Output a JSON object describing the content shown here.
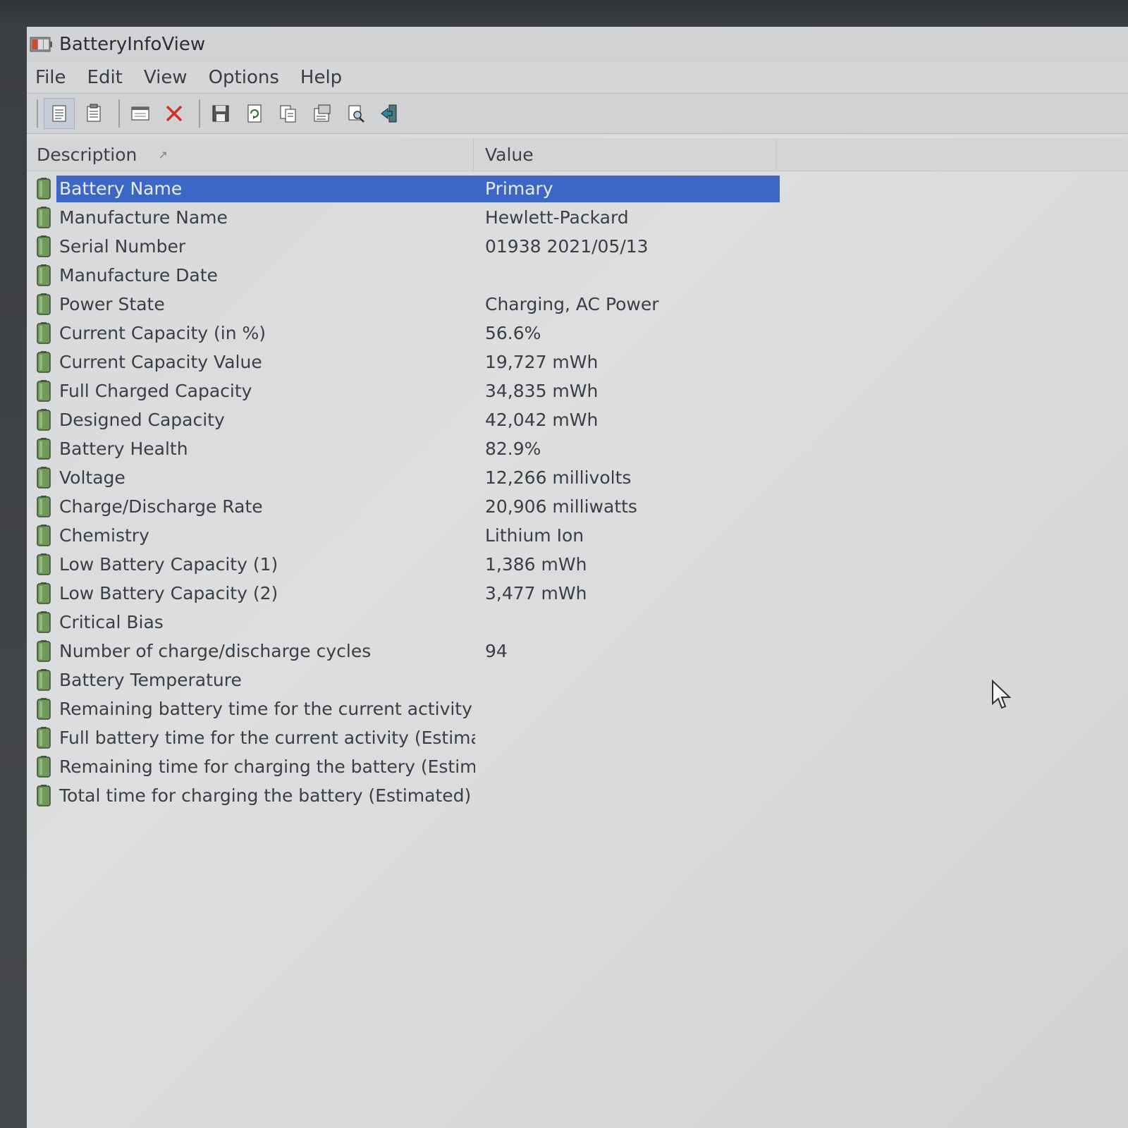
{
  "window": {
    "title": "BatteryInfoView"
  },
  "menu": [
    "File",
    "Edit",
    "View",
    "Options",
    "Help"
  ],
  "toolbar": {
    "buttons": [
      "properties-icon",
      "report-icon",
      "window-icon",
      "delete-icon",
      "save-icon",
      "refresh-icon",
      "copy-icon",
      "options-icon",
      "search-icon",
      "exit-icon"
    ]
  },
  "columns": {
    "description": "Description",
    "value": "Value"
  },
  "rows": [
    {
      "description": "Battery Name",
      "value": "Primary"
    },
    {
      "description": "Manufacture Name",
      "value": "Hewlett-Packard"
    },
    {
      "description": "Serial Number",
      "value": "01938 2021/05/13"
    },
    {
      "description": "Manufacture Date",
      "value": ""
    },
    {
      "description": "Power State",
      "value": "Charging, AC Power"
    },
    {
      "description": "Current Capacity (in %)",
      "value": "56.6%"
    },
    {
      "description": "Current Capacity Value",
      "value": "19,727 mWh"
    },
    {
      "description": "Full Charged Capacity",
      "value": "34,835 mWh"
    },
    {
      "description": "Designed Capacity",
      "value": "42,042 mWh"
    },
    {
      "description": "Battery Health",
      "value": "82.9%"
    },
    {
      "description": "Voltage",
      "value": "12,266 millivolts"
    },
    {
      "description": "Charge/Discharge Rate",
      "value": "20,906 milliwatts"
    },
    {
      "description": "Chemistry",
      "value": "Lithium Ion"
    },
    {
      "description": "Low Battery Capacity (1)",
      "value": "1,386 mWh"
    },
    {
      "description": "Low Battery Capacity (2)",
      "value": "3,477 mWh"
    },
    {
      "description": "Critical Bias",
      "value": ""
    },
    {
      "description": "Number of charge/discharge cycles",
      "value": "94"
    },
    {
      "description": "Battery Temperature",
      "value": ""
    },
    {
      "description": "Remaining battery time for the current activity (Esti...",
      "value": ""
    },
    {
      "description": "Full battery time for the current activity (Estimated)",
      "value": ""
    },
    {
      "description": "Remaining time for charging the battery (Estimated)",
      "value": ""
    },
    {
      "description": "Total  time for charging the battery (Estimated)",
      "value": ""
    }
  ],
  "selected_row": 0,
  "colors": {
    "selection": "#3c67c6",
    "battery_icon": "#6f9a5a"
  }
}
